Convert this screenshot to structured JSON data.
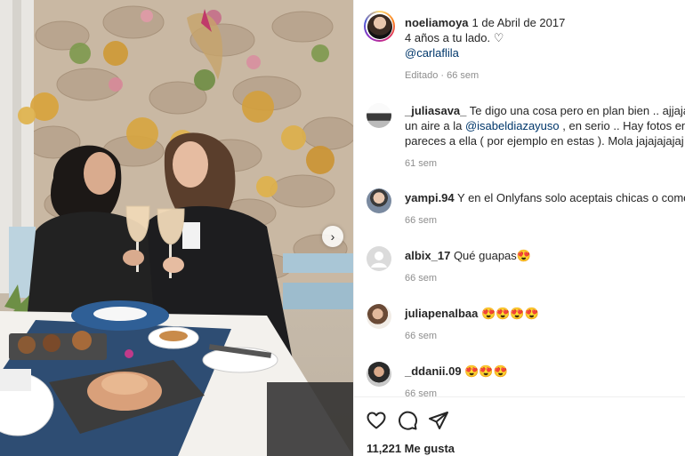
{
  "post": {
    "username": "noeliamoya",
    "date": "1 de Abril de 2017",
    "caption": "4 años a tu lado. ♡",
    "mention": "@carlaflila",
    "edited": "Editado · 66 sem"
  },
  "comments": [
    {
      "username": "_juliasava_",
      "line1": " Te digo una cosa pero en plan bien .. ajjaja Te",
      "line2_pre": "un aire a la ",
      "line2_mention": "@isabeldiazayuso",
      "line2_post": " , en serio .. Hay fotos en cu",
      "line3": "pareces a ella ( por ejemplo en estas ). Mola jajajajajaj",
      "meta": "61 sem"
    },
    {
      "username": "yampi.94",
      "text": " Y en el Onlyfans solo aceptais chicas o como v",
      "meta": "66 sem"
    },
    {
      "username": "albix_17",
      "text": " Qué guapas😍",
      "meta": "66 sem"
    },
    {
      "username": "juliapenalbaa",
      "text": " 😍😍😍😍",
      "meta": "66 sem"
    },
    {
      "username": "_ddanii.09",
      "text": " 😍😍😍",
      "meta": "66 sem"
    }
  ],
  "actions": {
    "like_icon": "heart-icon",
    "comment_icon": "comment-bubble-icon",
    "share_icon": "paper-plane-icon",
    "likes_text": "11,221 Me gusta"
  },
  "photo": {
    "next_icon": "chevron-right-icon"
  }
}
